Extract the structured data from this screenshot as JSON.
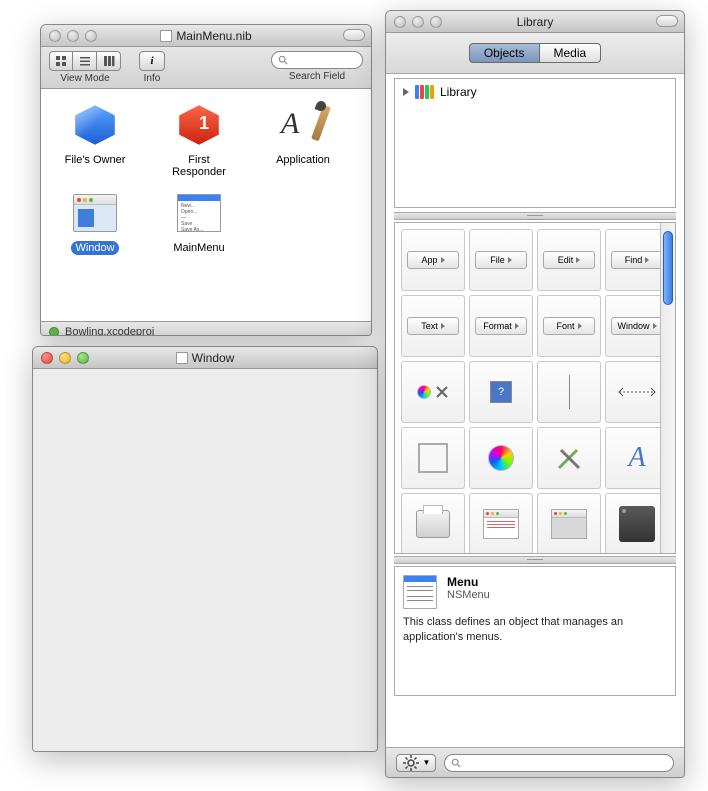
{
  "nib_window": {
    "title": "MainMenu.nib",
    "toolbar": {
      "viewmode_label": "View Mode",
      "info_label": "Info",
      "search_label": "Search Field",
      "search_placeholder": ""
    },
    "items": [
      {
        "label": "File's Owner"
      },
      {
        "label": "First Responder"
      },
      {
        "label": "Application"
      },
      {
        "label": "Window",
        "selected": true
      },
      {
        "label": "MainMenu"
      }
    ],
    "status": "Bowling.xcodeproj"
  },
  "window_window": {
    "title": "Window"
  },
  "library": {
    "title": "Library",
    "tabs": {
      "objects": "Objects",
      "media": "Media"
    },
    "outline_root": "Library",
    "object_buttons": [
      "App",
      "File",
      "Edit",
      "Find",
      "Text",
      "Format",
      "Font",
      "Window"
    ],
    "info": {
      "title": "Menu",
      "subtitle": "NSMenu",
      "description": "This class defines an object that manages an application's menus."
    },
    "footer_search_placeholder": ""
  }
}
